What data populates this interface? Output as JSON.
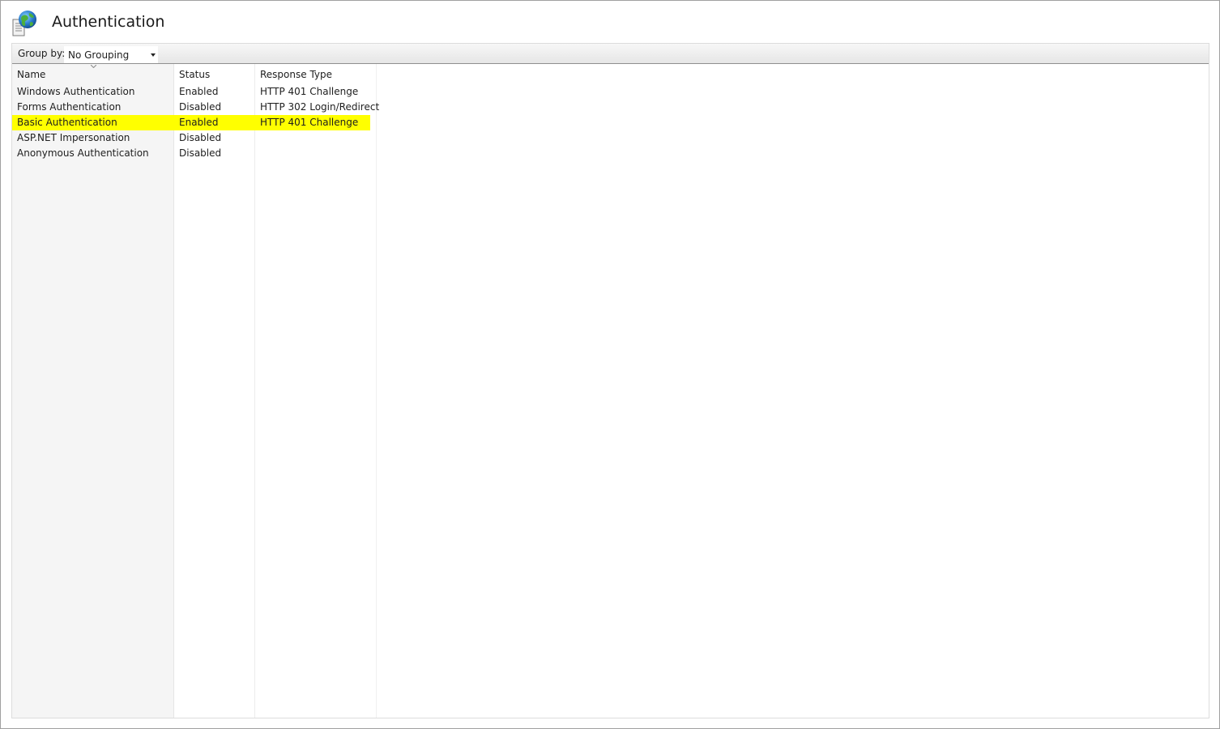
{
  "header": {
    "title": "Authentication",
    "icon": "globe-document-icon"
  },
  "toolbar": {
    "group_by_label": "Group by:",
    "group_by_value": "No Grouping"
  },
  "table": {
    "columns": [
      "Name",
      "Status",
      "Response Type"
    ],
    "rows": [
      {
        "name": "Windows Authentication",
        "status": "Enabled",
        "response": "HTTP 401 Challenge",
        "highlighted": false
      },
      {
        "name": "Forms Authentication",
        "status": "Disabled",
        "response": "HTTP 302 Login/Redirect",
        "highlighted": false
      },
      {
        "name": "Basic Authentication",
        "status": "Enabled",
        "response": "HTTP 401 Challenge",
        "highlighted": true
      },
      {
        "name": "ASP.NET Impersonation",
        "status": "Disabled",
        "response": "",
        "highlighted": false
      },
      {
        "name": "Anonymous Authentication",
        "status": "Disabled",
        "response": "",
        "highlighted": false
      }
    ]
  },
  "colors": {
    "highlight": "#ffff00",
    "name_column_bg": "#f5f5f5"
  }
}
